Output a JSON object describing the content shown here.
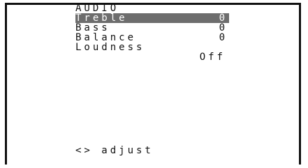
{
  "menu": {
    "title": "AUDIO",
    "items": [
      {
        "label": "Treble",
        "value": "0",
        "selected": true
      },
      {
        "label": "Bass",
        "value": "0",
        "selected": false
      },
      {
        "label": "Balance",
        "value": "0",
        "selected": false
      },
      {
        "label": "Loudness",
        "value": "",
        "selected": false
      }
    ],
    "loudness_value": "Off"
  },
  "footer": {
    "hint": "<> adjust"
  },
  "colors": {
    "highlight_bg": "#6d6d6d",
    "highlight_text": "#ffffff",
    "text": "#111111",
    "background": "#ffffff"
  }
}
